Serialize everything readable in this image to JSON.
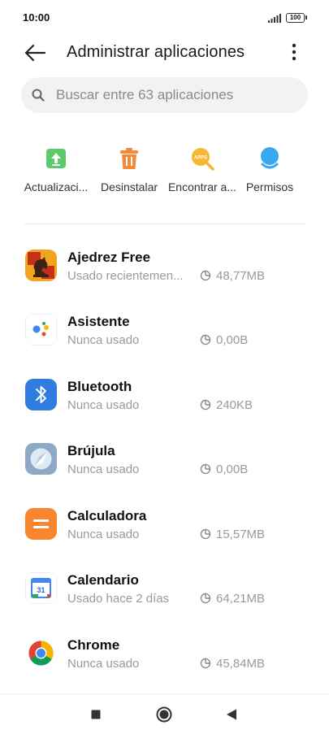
{
  "status_bar": {
    "time": "10:00",
    "battery": "100"
  },
  "header": {
    "title": "Administrar aplicaciones"
  },
  "search": {
    "placeholder": "Buscar entre 63 aplicaciones"
  },
  "quick_actions": [
    {
      "label": "Actualizaci...",
      "icon": "update-icon",
      "color": "#5cc96b"
    },
    {
      "label": "Desinstalar",
      "icon": "trash-icon",
      "color": "#f5893a"
    },
    {
      "label": "Encontrar a...",
      "icon": "find-apps-icon",
      "color": "#f7b731"
    },
    {
      "label": "Permisos",
      "icon": "permissions-icon",
      "color": "#3aa8f0"
    }
  ],
  "apps": [
    {
      "name": "Ajedrez Free",
      "status": "Usado recientemen...",
      "size": "48,77MB",
      "icon": "chess-app-icon"
    },
    {
      "name": "Asistente",
      "status": "Nunca usado",
      "size": "0,00B",
      "icon": "assistant-app-icon"
    },
    {
      "name": "Bluetooth",
      "status": "Nunca usado",
      "size": "240KB",
      "icon": "bluetooth-app-icon"
    },
    {
      "name": "Brújula",
      "status": "Nunca usado",
      "size": "0,00B",
      "icon": "compass-app-icon"
    },
    {
      "name": "Calculadora",
      "status": "Nunca usado",
      "size": "15,57MB",
      "icon": "calculator-app-icon"
    },
    {
      "name": "Calendario",
      "status": "Usado hace 2 días",
      "size": "64,21MB",
      "icon": "calendar-app-icon"
    },
    {
      "name": "Chrome",
      "status": "Nunca usado",
      "size": "45,84MB",
      "icon": "chrome-app-icon"
    }
  ],
  "calendar_day": "31",
  "find_apps_badge": "APPS",
  "colors": {
    "accent": "#3aa8f0",
    "text_secondary": "#9a9a9a",
    "search_bg": "#f2f2f2"
  }
}
